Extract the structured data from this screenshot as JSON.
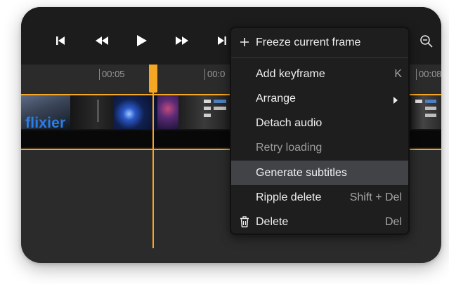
{
  "timeline": {
    "ticks": [
      "00:05",
      "00:0",
      "00:08"
    ]
  },
  "clip": {
    "brand_text": "flixier"
  },
  "toolbar": {
    "icons": [
      "skip-back-icon",
      "rewind-icon",
      "play-icon",
      "fast-forward-icon",
      "skip-forward-icon",
      "zoom-out-icon"
    ]
  },
  "context_menu": {
    "items": [
      {
        "label": "Freeze current frame",
        "icon": "plus-icon",
        "shortcut": ""
      },
      {
        "label": "Add keyframe",
        "shortcut": "K"
      },
      {
        "label": "Arrange",
        "submenu": true,
        "shortcut": ""
      },
      {
        "label": "Detach audio",
        "shortcut": ""
      },
      {
        "label": "Retry loading",
        "disabled": true,
        "shortcut": ""
      },
      {
        "label": "Generate subtitles",
        "highlighted": true,
        "shortcut": ""
      },
      {
        "label": "Ripple delete",
        "shortcut": "Shift + Del"
      },
      {
        "label": "Delete",
        "icon": "trash-icon",
        "shortcut": "Del"
      }
    ]
  },
  "colors": {
    "accent": "#f5a623",
    "brand": "#2a7ee8",
    "menu_bg": "#1e1e1e",
    "highlight": "#414346"
  }
}
